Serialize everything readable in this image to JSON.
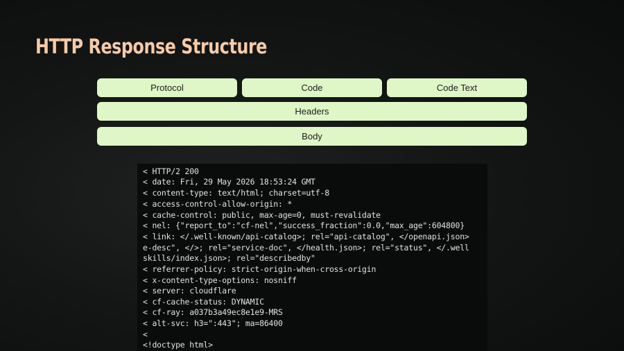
{
  "slide": {
    "title": "HTTP Response Structure"
  },
  "diagram": {
    "row1": [
      "Protocol",
      "Code",
      "Code Text"
    ],
    "headers_label": "Headers",
    "body_label": "Body"
  },
  "terminal": {
    "lines": [
      "< HTTP/2 200",
      "< date: Fri, 29 May 2026 18:53:24 GMT",
      "< content-type: text/html; charset=utf-8",
      "< access-control-allow-origin: *",
      "< cache-control: public, max-age=0, must-revalidate",
      "< nel: {\"report_to\":\"cf-nel\",\"success_fraction\":0.0,\"max_age\":604800}",
      "< link: </.well-known/api-catalog>; rel=\"api-catalog\", </openapi.json>",
      "e-desc\", </>; rel=\"service-doc\", </health.json>; rel=\"status\", </.well",
      "skills/index.json>; rel=\"describedby\"",
      "< referrer-policy: strict-origin-when-cross-origin",
      "< x-content-type-options: nosniff",
      "< server: cloudflare",
      "< cf-cache-status: DYNAMIC",
      "< cf-ray: a037b3a49ec8e1e9-MRS",
      "< alt-svc: h3=\":443\"; ma=86400",
      "<",
      "<!doctype html>"
    ]
  }
}
